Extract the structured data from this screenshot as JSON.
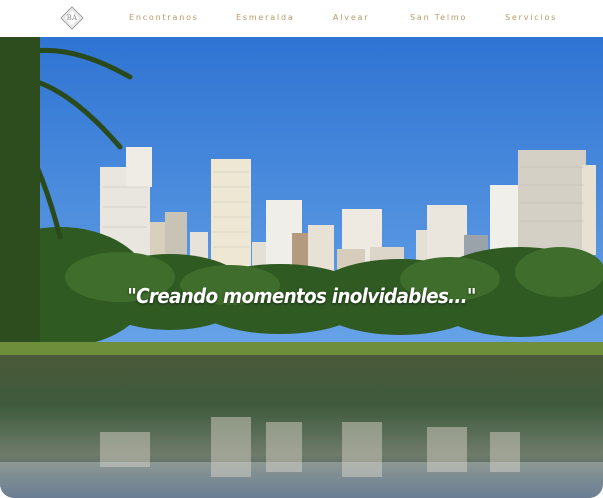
{
  "logo": {
    "text": "BA",
    "icon": "diamond-logo-icon"
  },
  "nav": {
    "items": [
      {
        "label": "Encontranos"
      },
      {
        "label": "Esmeralda"
      },
      {
        "label": "Alvear"
      },
      {
        "label": "San Telmo"
      },
      {
        "label": "Servicios"
      }
    ]
  },
  "hero": {
    "tagline": "\"Creando momentos inolvidables...\"",
    "image": "city-park-lake-photo"
  },
  "colors": {
    "nav_text": "#b59a6b",
    "sky": "#3a7fd6",
    "tagline": "#ffffff"
  }
}
